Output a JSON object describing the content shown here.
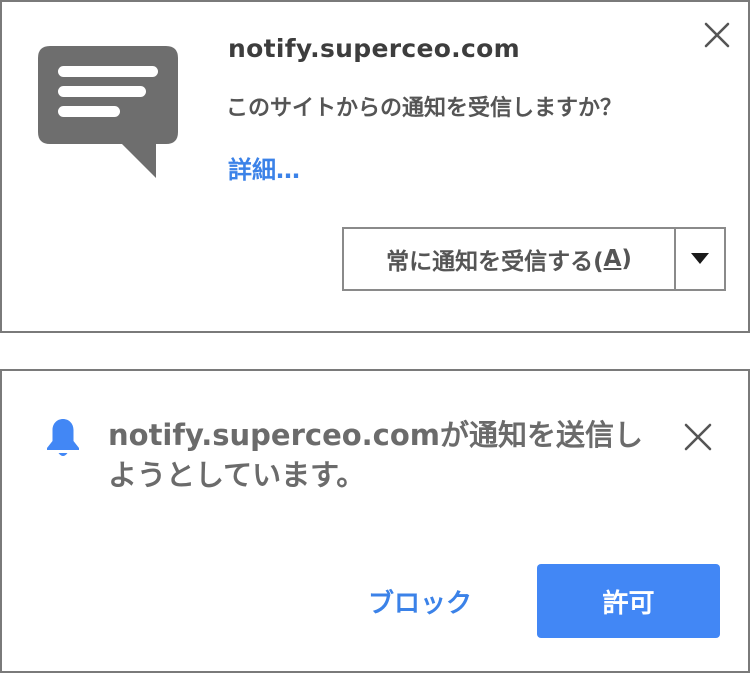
{
  "prompt_top": {
    "domain": "notify.superceo.com",
    "question": "このサイトからの通知を受信しますか？",
    "details_link": "詳細…",
    "action_label_prefix": "常に通知を受信する(",
    "action_label_key": "A",
    "action_label_suffix": ")",
    "icons": {
      "message": "chat-bubble-icon",
      "close": "close-icon",
      "dropdown": "dropdown-arrow-icon"
    }
  },
  "prompt_bottom": {
    "message": "notify.superceo.comが通知を送信しようとしています。",
    "block_button": "ブロック",
    "allow_button": "許可",
    "icons": {
      "bell": "bell-icon",
      "close": "close-icon"
    }
  },
  "colors": {
    "link_blue": "#3b82e8",
    "allow_button_bg": "#4287f5",
    "icon_gray": "#6e6e6e",
    "border_gray": "#7a7a7a"
  }
}
